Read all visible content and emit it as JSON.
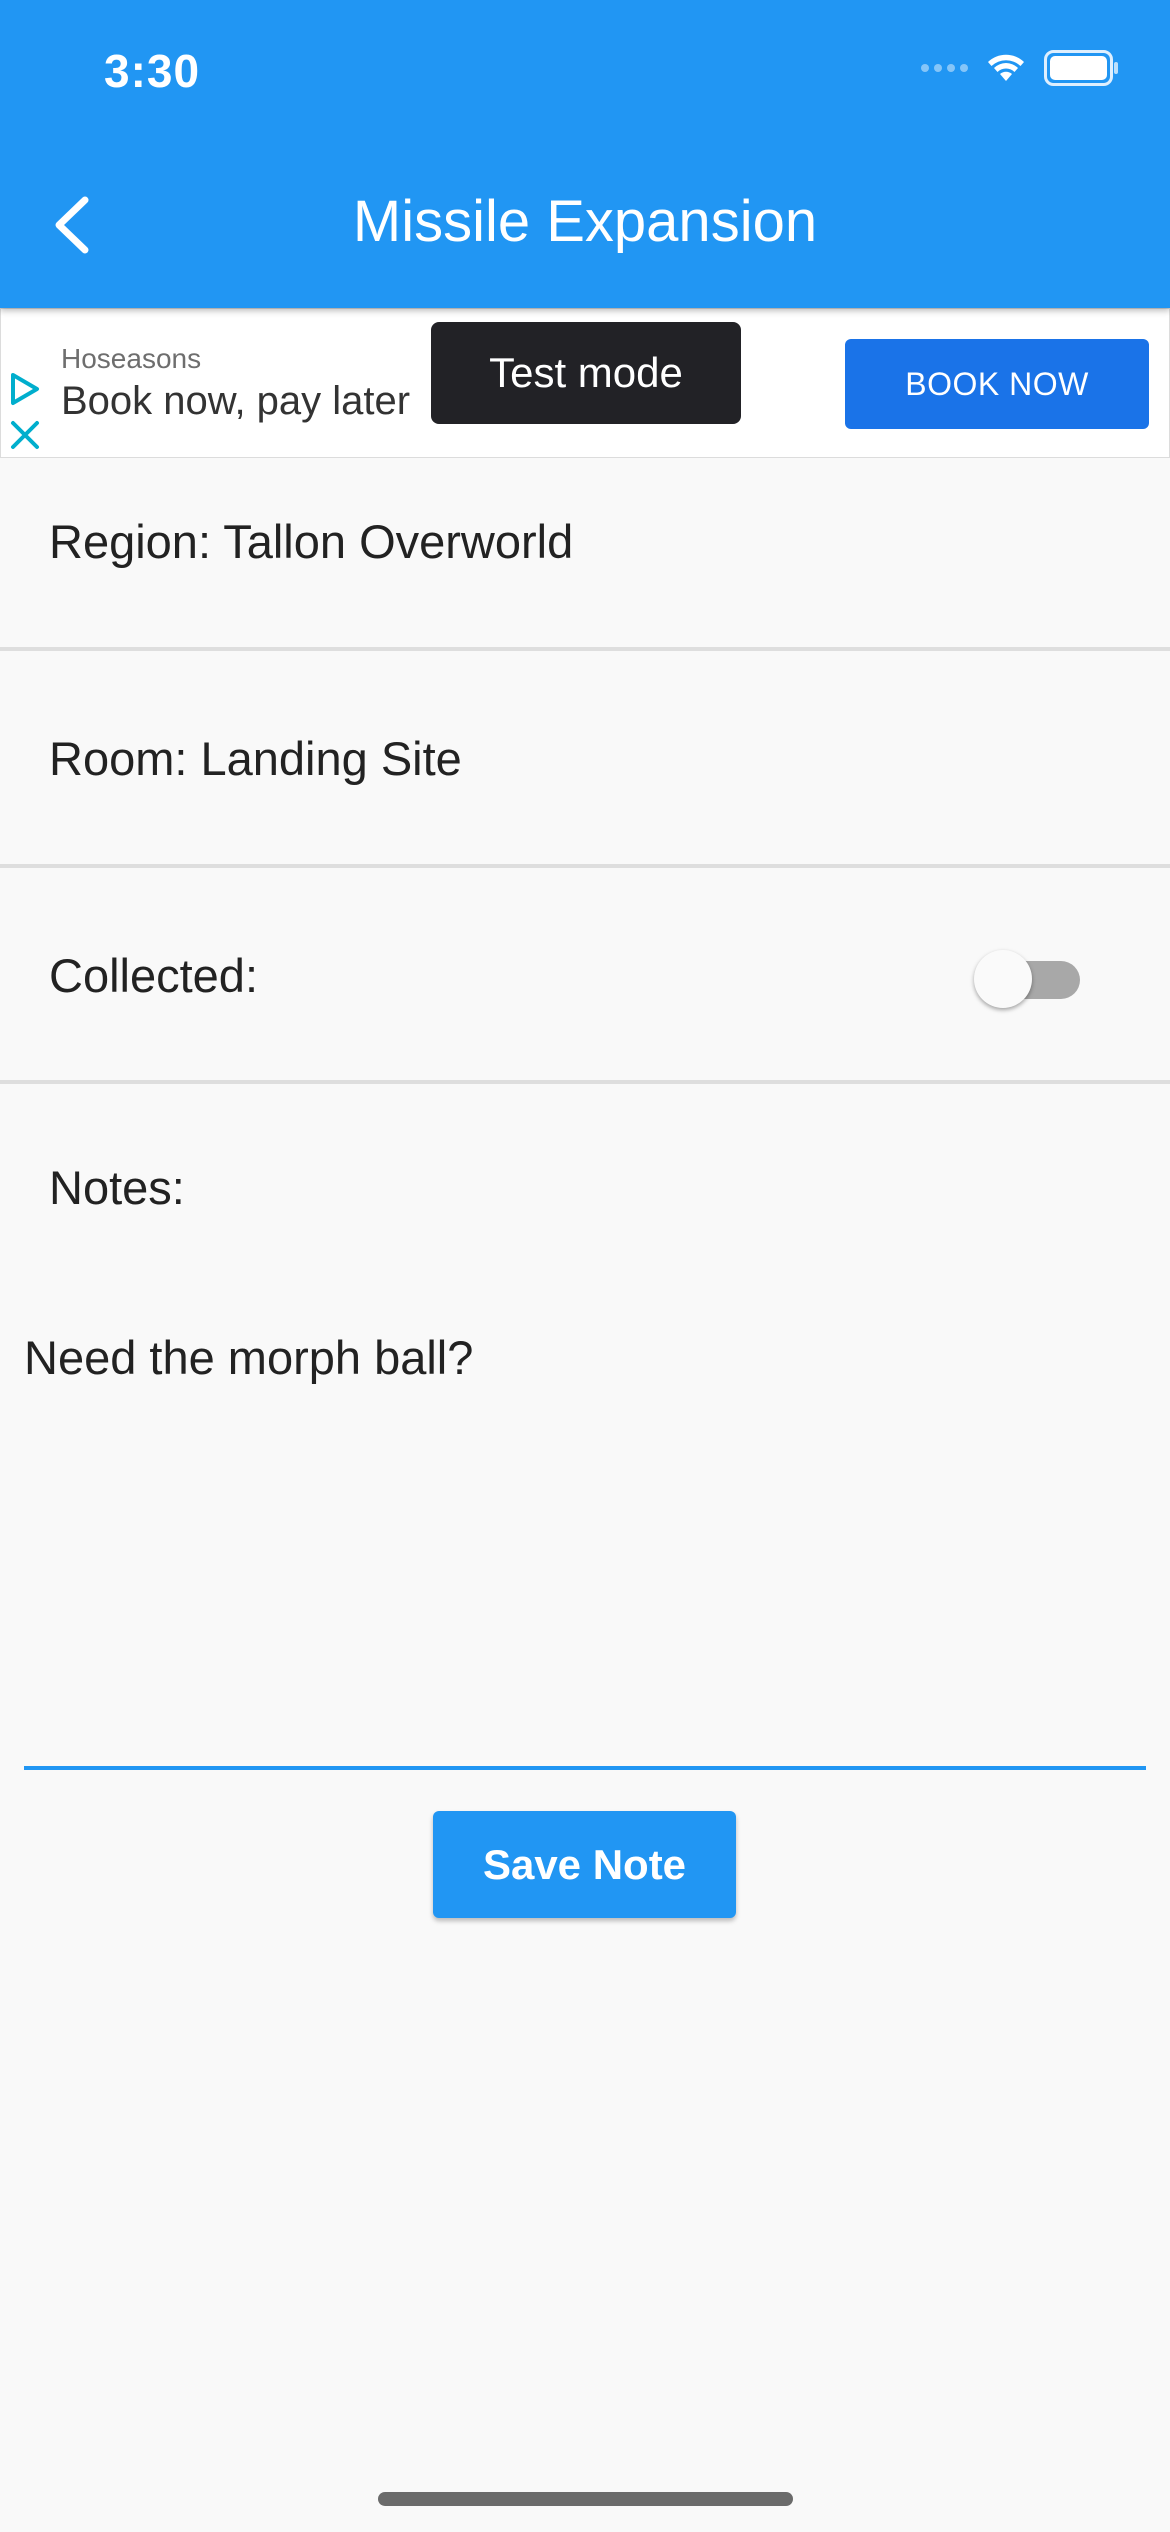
{
  "status_bar": {
    "time": "3:30",
    "icons": [
      "cellular-signal-icon",
      "wifi-icon",
      "battery-icon"
    ]
  },
  "app_bar": {
    "title": "Missile Expansion",
    "back_icon": "chevron-left-icon",
    "color": "#2196f3"
  },
  "ad": {
    "advertiser": "Hoseasons",
    "headline": "Book now, pay later",
    "badge": "Test mode",
    "cta": "BOOK NOW",
    "cta_color": "#1a73e8",
    "icons": [
      "ad-choices-icon",
      "ad-close-icon"
    ]
  },
  "fields": {
    "region": "Region: Tallon Overworld",
    "room": "Room: Landing Site",
    "collected_label": "Collected:",
    "collected_value": false
  },
  "notes": {
    "label": "Notes:",
    "value": "Need the morph ball?"
  },
  "actions": {
    "save_label": "Save Note"
  },
  "colors": {
    "accent": "#2196f3",
    "background": "#f9f9f9"
  }
}
